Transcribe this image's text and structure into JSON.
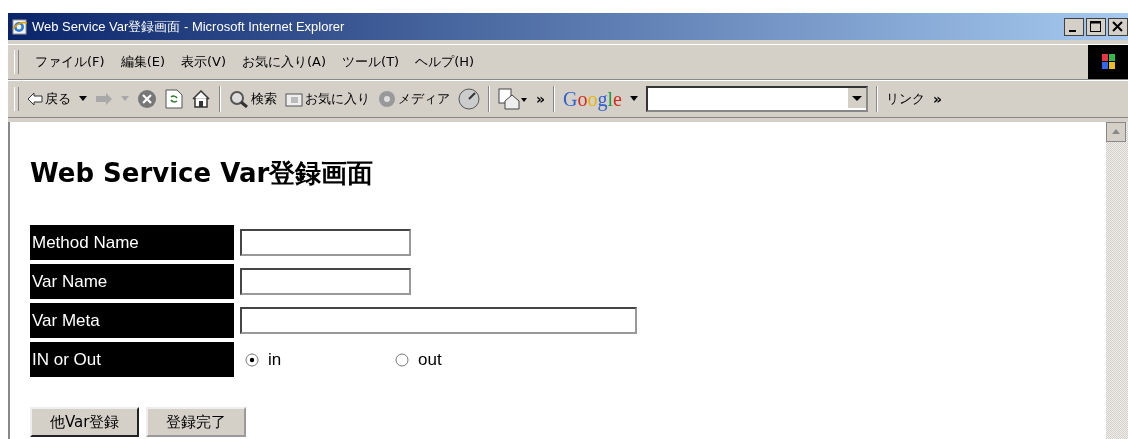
{
  "window": {
    "title": "Web Service Var登録画面 - Microsoft Internet Explorer"
  },
  "menu": [
    "ファイル(F)",
    "編集(E)",
    "表示(V)",
    "お気に入り(A)",
    "ツール(T)",
    "ヘルプ(H)"
  ],
  "toolbar": {
    "back": "戻る",
    "forward_disabled": true,
    "search": "検索",
    "favorites": "お気に入り",
    "media": "メディア",
    "more": "»",
    "google": "Google",
    "links": "リンク",
    "links_more": "»"
  },
  "page": {
    "heading": "Web Service Var登録画面",
    "fields": [
      {
        "label": "Method Name",
        "kind": "text"
      },
      {
        "label": "Var Name",
        "kind": "text"
      },
      {
        "label": "Var Meta",
        "kind": "wide_text"
      },
      {
        "label": "IN or Out",
        "kind": "radio",
        "options": [
          {
            "label": "in",
            "selected": true
          },
          {
            "label": "out",
            "selected": false
          }
        ]
      }
    ],
    "buttons": [
      "他Var登録",
      "登録完了"
    ]
  }
}
